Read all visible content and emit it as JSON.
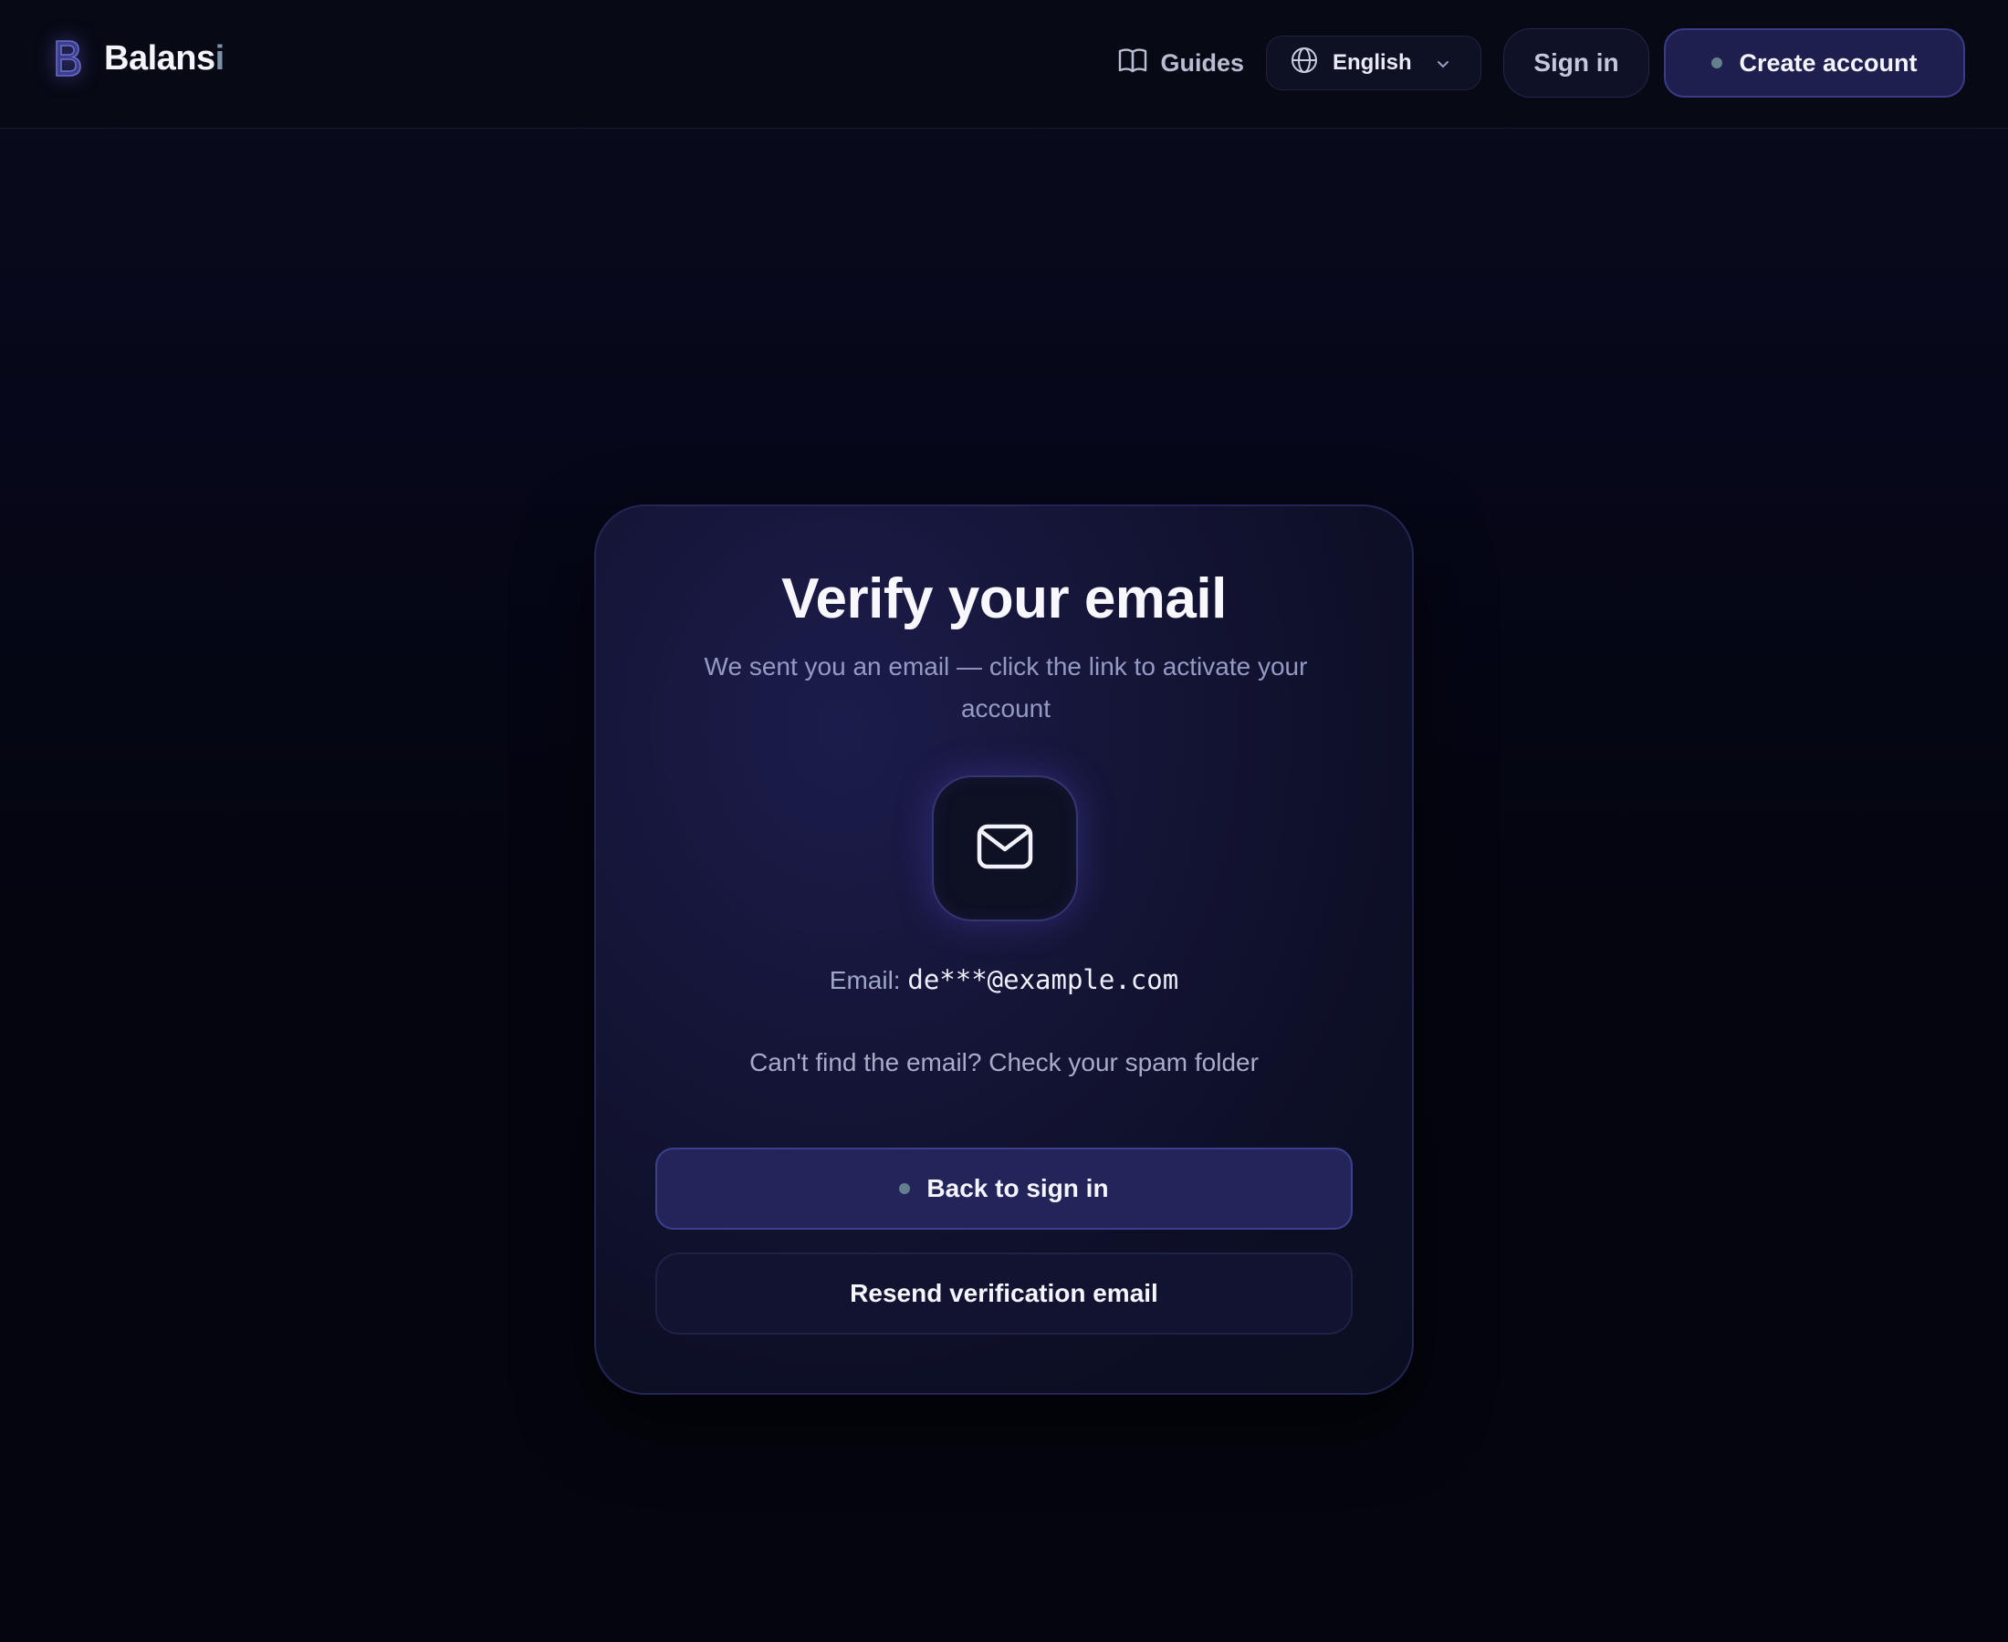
{
  "brand": {
    "name_main": "Balans",
    "name_accent": "i",
    "logo_letter": "B"
  },
  "header": {
    "guides_label": "Guides",
    "language": "English",
    "sign_in_label": "Sign in",
    "create_account_label": "Create account"
  },
  "card": {
    "title": "Verify your email",
    "subtitle": "We sent you an email — click the link to activate your account",
    "email_label": "Email:",
    "email_value": "de***@example.com",
    "spam_hint": "Can't find the email? Check your spam folder",
    "back_button_label": "Back to sign in",
    "resend_button_label": "Resend verification email"
  },
  "icons": {
    "logo": "letter-b-logo-icon",
    "guides": "book-open-icon",
    "language": "globe-icon",
    "language_chevron": "chevron-down-icon",
    "mail": "envelope-icon",
    "status_dot": "dot-icon"
  },
  "colors": {
    "background": "#05060f",
    "card": "#151538",
    "primary_button": "#23245a",
    "primary_border": "#3d3f8e",
    "muted_text": "#959ac4",
    "dot": "#63808c"
  }
}
